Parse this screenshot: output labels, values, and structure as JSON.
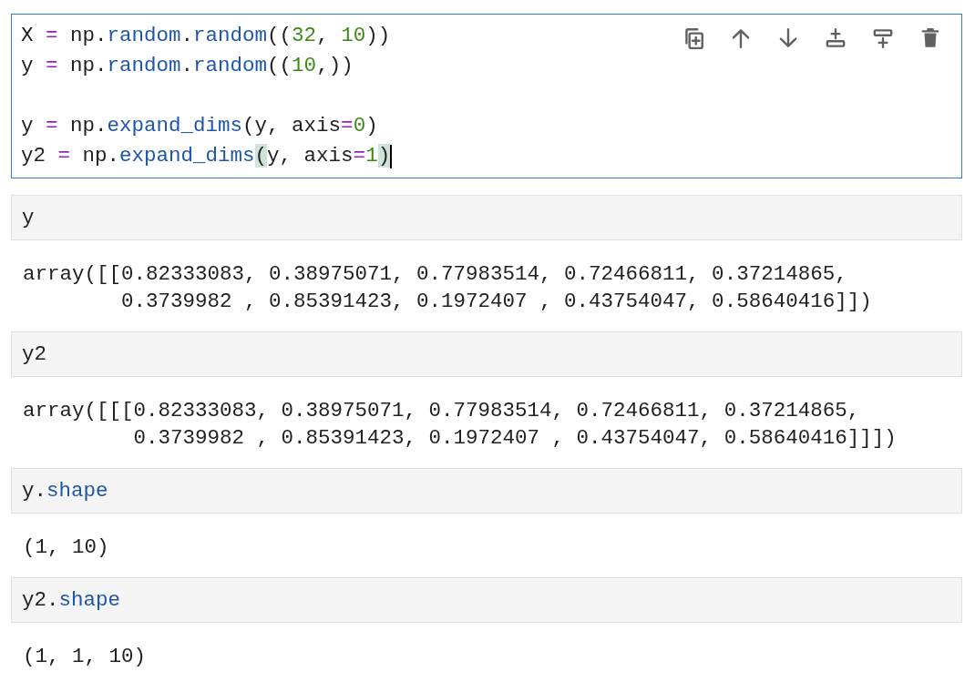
{
  "active_cell": {
    "selected": true,
    "lines": [
      {
        "kind": "code",
        "cursor": false,
        "tokens": [
          {
            "text": "X ",
            "kind": "plain"
          },
          {
            "text": "=",
            "kind": "operator"
          },
          {
            "text": " np.",
            "kind": "plain"
          },
          {
            "text": "random",
            "kind": "attr"
          },
          {
            "text": ".",
            "kind": "plain"
          },
          {
            "text": "random",
            "kind": "attr"
          },
          {
            "text": "((",
            "kind": "plain"
          },
          {
            "text": "32",
            "kind": "number"
          },
          {
            "text": ", ",
            "kind": "plain"
          },
          {
            "text": "10",
            "kind": "number"
          },
          {
            "text": "))",
            "kind": "plain"
          }
        ]
      },
      {
        "kind": "code",
        "cursor": false,
        "tokens": [
          {
            "text": "y ",
            "kind": "plain"
          },
          {
            "text": "=",
            "kind": "operator"
          },
          {
            "text": " np.",
            "kind": "plain"
          },
          {
            "text": "random",
            "kind": "attr"
          },
          {
            "text": ".",
            "kind": "plain"
          },
          {
            "text": "random",
            "kind": "attr"
          },
          {
            "text": "((",
            "kind": "plain"
          },
          {
            "text": "10",
            "kind": "number"
          },
          {
            "text": ",))",
            "kind": "plain"
          }
        ]
      },
      {
        "kind": "blank"
      },
      {
        "kind": "code",
        "cursor": false,
        "tokens": [
          {
            "text": "y ",
            "kind": "plain"
          },
          {
            "text": "=",
            "kind": "operator"
          },
          {
            "text": " np.",
            "kind": "plain"
          },
          {
            "text": "expand_dims",
            "kind": "attr"
          },
          {
            "text": "(y, axis",
            "kind": "plain"
          },
          {
            "text": "=",
            "kind": "operator"
          },
          {
            "text": "0",
            "kind": "number"
          },
          {
            "text": ")",
            "kind": "plain"
          }
        ]
      },
      {
        "kind": "code",
        "cursor": true,
        "tokens": [
          {
            "text": "y2 ",
            "kind": "plain"
          },
          {
            "text": "=",
            "kind": "operator"
          },
          {
            "text": " np.",
            "kind": "plain"
          },
          {
            "text": "expand_dims",
            "kind": "attr"
          },
          {
            "text": "(",
            "kind": "match"
          },
          {
            "text": "y, axis",
            "kind": "plain"
          },
          {
            "text": "=",
            "kind": "operator"
          },
          {
            "text": "1",
            "kind": "number"
          },
          {
            "text": ")",
            "kind": "match"
          }
        ]
      }
    ]
  },
  "cells": [
    {
      "input": [
        {
          "text": "y",
          "kind": "plain"
        }
      ],
      "output": [
        "array([[0.82333083, 0.38975071, 0.77983514, 0.72466811, 0.37214865,",
        "        0.3739982 , 0.85391423, 0.1972407 , 0.43754047, 0.58640416]])"
      ]
    },
    {
      "input": [
        {
          "text": "y2",
          "kind": "plain"
        }
      ],
      "output": [
        "array([[[0.82333083, 0.38975071, 0.77983514, 0.72466811, 0.37214865,",
        "         0.3739982 , 0.85391423, 0.1972407 , 0.43754047, 0.58640416]]])"
      ]
    },
    {
      "input": [
        {
          "text": "y.",
          "kind": "plain"
        },
        {
          "text": "shape",
          "kind": "attr"
        }
      ],
      "output": [
        "(1, 10)"
      ]
    },
    {
      "input": [
        {
          "text": "y2.",
          "kind": "plain"
        },
        {
          "text": "shape",
          "kind": "attr"
        }
      ],
      "output": [
        "(1, 1, 10)"
      ]
    }
  ]
}
